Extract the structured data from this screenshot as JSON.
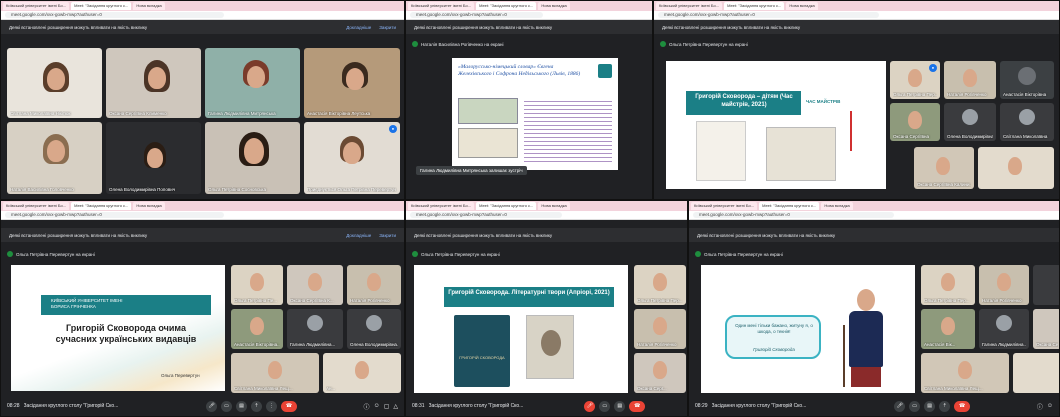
{
  "browser": {
    "tab_uni": "Київський університет імені Бо...",
    "tab_meet": "Meet: \"Засідання круглого с...",
    "tab_new": "Нова вкладка",
    "url": "meet.google.com/xvx-gowb-mwp?authuser=0"
  },
  "warning": {
    "message": "Деякі встановлені розширення можуть впливати на якість виклику",
    "details": "Докладніше",
    "close": "Закрити"
  },
  "panels": {
    "p1": {
      "tiles": [
        "Світлана Миколаївна Нікітюк",
        "Оксана Сергіївна Клименко",
        "Галина Людмилівна Митрянська",
        "Анастасія Вікторівна Леутська",
        "Наталія Василівна Головченко",
        "Олена Володимирівна Попович",
        "Ольга Петрівна Сосновська",
        "Приєднується Ольга Петрівна Перевертун"
      ]
    },
    "p2": {
      "presenter": "Наталія Василівна Рогівченко на екрані",
      "slide_title": "«Малоруссько-німецький словар» Євгена Желехівського і Софрона Недільського (Львів, 1886)",
      "toast": "Галина Людмилівна Митрянська залишає зустріч"
    },
    "p3": {
      "presenter": "Ольга Петрівна Перевертун на екрані",
      "slide_title": "Григорій Сковорода – дітям (Час майстрів, 2021)",
      "logo": "ЧАС МАЙСТРІВ",
      "tiles": [
        "Ольга Петрівна Пер...",
        "Наталія Рогівченко",
        "Анастасія Вікторівна",
        "Оксана Сергіївна",
        "Олена Володимирівна",
        "Світлана Миколаївна",
        "Оксана Сергіївна Калини..."
      ]
    },
    "p4": {
      "presenter": "Ольга Петрівна Перевертун на екрані",
      "slide_title": "Григорій Сковорода очима сучасних українських видавців",
      "univ": "КИЇВСЬКИЙ УНІВЕРСИТЕТ ІМЕНІ БОРИСА ГРІНЧЕНКА",
      "author": "Ольга Перевертун",
      "tiles": [
        "Ольга Петрівна Пе...",
        "Оксана Сергіївна К...",
        "Наталія Рогівченко",
        "Анастасія Вікторівна...",
        "Галина Людмилівна...",
        "Олена Володимирівна...",
        "Світлана Миколаївна Лещ...",
        "Ан..."
      ],
      "clock": "08:28",
      "meeting": "Засідання круглого столу \"Григорій Ско..."
    },
    "p5": {
      "presenter": "Ольга Петрівна Перевертун на екрані",
      "slide_title": "Григорій Сковорода. Літературні твори (Апріорі, 2021)",
      "book": "ГРИГОРІЙ СКОВОРОДА",
      "tiles": [
        "Ольга Петрівна Пер...",
        "Наталія Рогівченко",
        "Оксана Серг..."
      ],
      "clock": "08:31",
      "meeting": "Засідання круглого столу \"Григорій Ско..."
    },
    "p6": {
      "presenter": "Ольга Петрівна Перевертун на екрані",
      "quote": "Один мені тільки бажано, житуну я, о шкода, о текнія!",
      "quote_author": "Григорій Сковорода",
      "tiles": [
        "Ольга Петрівна Пер...",
        "Наталія Рогівченко",
        "Анастасія Вік...",
        "Галина Людмилівна...",
        "Оксана Серг...",
        "Світлана Миколаївна Лещ..."
      ],
      "clock": "08:29",
      "meeting": "Засідання круглого столу \"Григорій Ско..."
    }
  },
  "colors": {
    "meet_bg": "#202124",
    "tab_strip": "#f3d3dc",
    "accent_teal": "#1b7f86",
    "end_call": "#ea4335",
    "presenter_dot": "#1e8e3e"
  }
}
